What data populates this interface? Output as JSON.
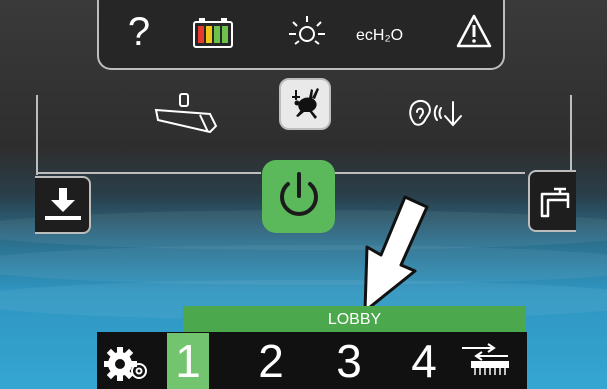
{
  "status_bar": {
    "help_icon": "?",
    "battery_icon": "battery-icon",
    "sun_icon": "sun-icon",
    "ech2o_label": "ecH₂O",
    "warning_icon": "warning-icon"
  },
  "mode_bar": {
    "brush_icon": "brush-icon",
    "rabbit_icon": "rabbit-icon",
    "ear_icon": "quiet-mode-icon"
  },
  "side_tabs": {
    "left_icon": "download-icon",
    "right_icon": "faucet-icon"
  },
  "zone_label": "LOBBY",
  "zone_numbers": [
    "1",
    "2",
    "3",
    "4"
  ],
  "selected_zone": "1",
  "colors": {
    "accent_green": "#5bb85b",
    "selected_green": "#73c46e",
    "outline": "#bdbdbd"
  }
}
